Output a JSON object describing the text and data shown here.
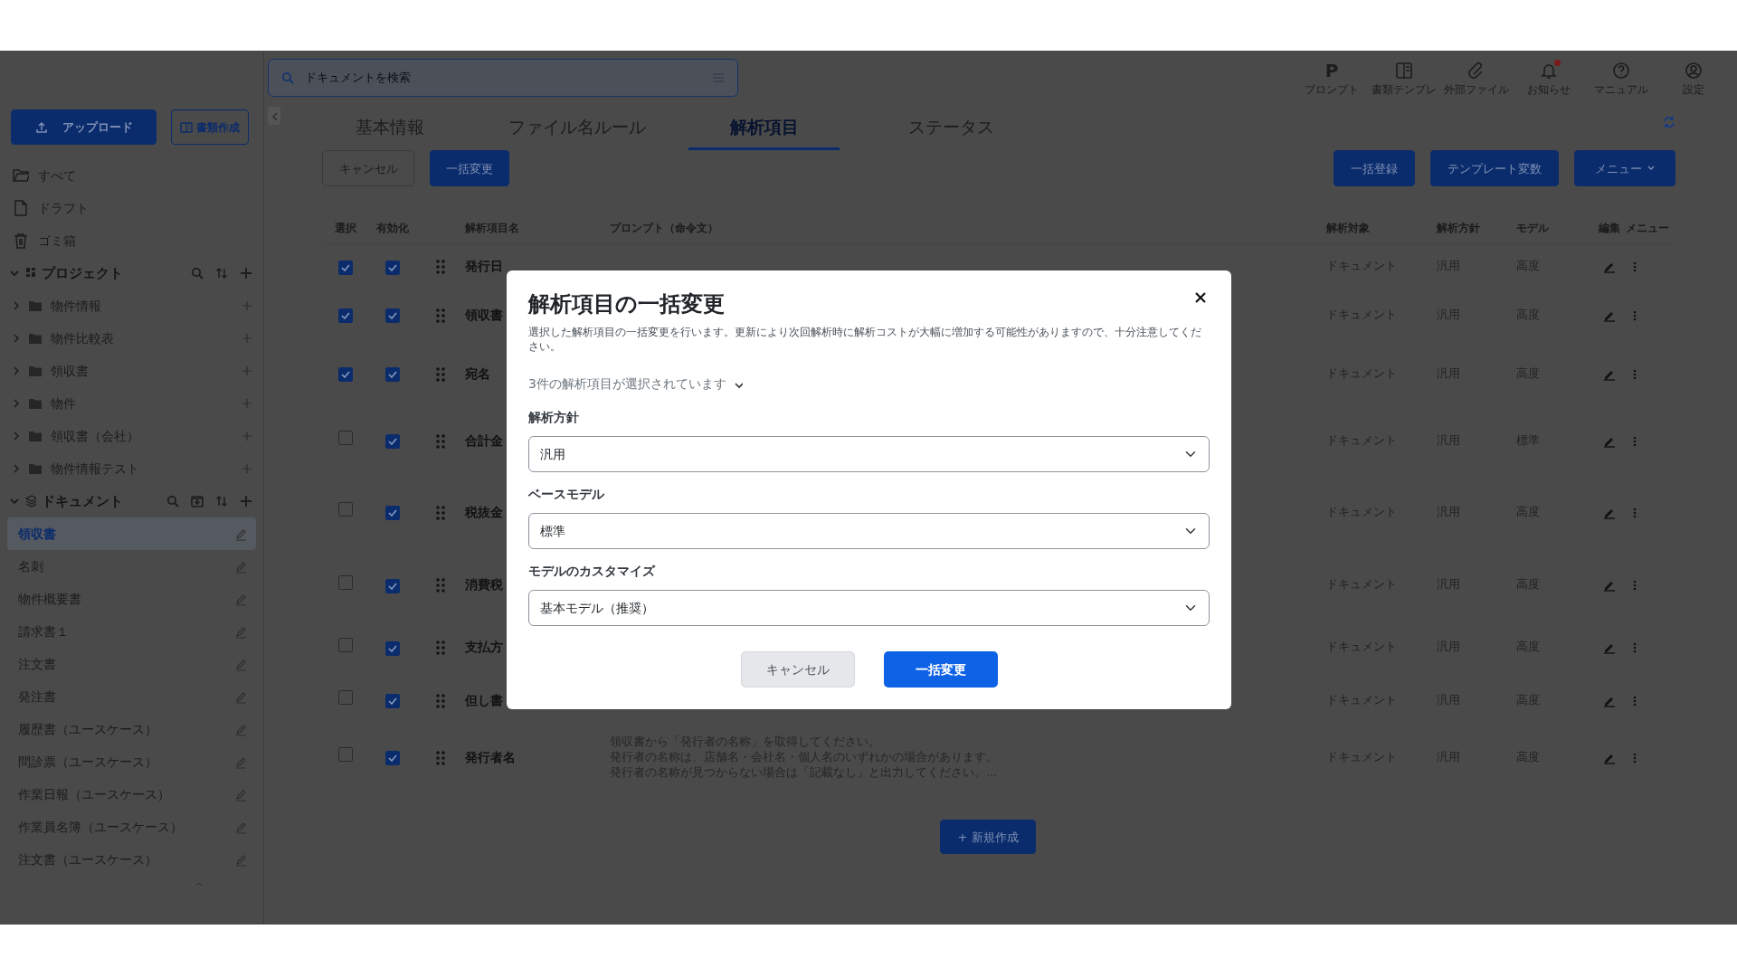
{
  "sidebar": {
    "upload_button": "アップロード",
    "create_button": "書類作成",
    "nav": [
      {
        "label": "すべて"
      },
      {
        "label": "ドラフト"
      },
      {
        "label": "ゴミ箱"
      }
    ],
    "projects": {
      "title": "プロジェクト",
      "expanded": true,
      "items": [
        {
          "label": "物件情報",
          "expanded": false
        },
        {
          "label": "物件比較表",
          "expanded": false
        },
        {
          "label": "領収書",
          "expanded": false
        },
        {
          "label": "物件",
          "expanded": false
        },
        {
          "label": "領収書（会社）",
          "expanded": false
        },
        {
          "label": "物件情報テスト",
          "expanded": false
        }
      ]
    },
    "documents": {
      "title": "ドキュメント",
      "expanded": true,
      "items": [
        {
          "label": "領収書",
          "selected": true
        },
        {
          "label": "名刺",
          "selected": false
        },
        {
          "label": "物件概要書",
          "selected": false
        },
        {
          "label": "請求書１",
          "selected": false
        },
        {
          "label": "注文書",
          "selected": false
        },
        {
          "label": "発注書",
          "selected": false
        },
        {
          "label": "履歴書（ユースケース）",
          "selected": false
        },
        {
          "label": "問診票（ユースケース）",
          "selected": false
        },
        {
          "label": "作業日報（ユースケース）",
          "selected": false
        },
        {
          "label": "作業員名簿（ユースケース）",
          "selected": false
        },
        {
          "label": "注文書（ユースケース）",
          "selected": false
        }
      ]
    }
  },
  "search": {
    "placeholder": "ドキュメントを検索"
  },
  "toolbar": [
    {
      "label": "プロンプト",
      "glyph": "P",
      "unread": false
    },
    {
      "label": "書類テンプレ",
      "unread": false
    },
    {
      "label": "外部ファイル",
      "unread": false
    },
    {
      "label": "お知らせ",
      "unread": true
    },
    {
      "label": "マニュアル",
      "unread": false
    },
    {
      "label": "設定",
      "unread": false
    }
  ],
  "tabs": [
    {
      "label": "基本情報",
      "selected": false
    },
    {
      "label": "ファイル名ルール",
      "selected": false
    },
    {
      "label": "解析項目",
      "selected": true
    },
    {
      "label": "ステータス",
      "selected": false
    }
  ],
  "actions_left": [
    "キャンセル",
    "一括変更"
  ],
  "actions_right": [
    "一括登録",
    "テンプレート変数",
    "メニュー"
  ],
  "table": {
    "columns": [
      "選択",
      "有効化",
      "解析項目名",
      "プロンプト（命令文）",
      "解析対象",
      "解析方針",
      "モデル",
      "編集",
      "メニュー"
    ],
    "rows": [
      {
        "selected": true,
        "enabled": true,
        "name": "発行日",
        "target": "ドキュメント",
        "policy": "汎用",
        "model": "高度"
      },
      {
        "selected": true,
        "enabled": true,
        "name": "領収書",
        "target": "ドキュメント",
        "policy": "汎用",
        "model": "高度"
      },
      {
        "selected": true,
        "enabled": true,
        "name": "宛名",
        "target": "ドキュメント",
        "policy": "汎用",
        "model": "高度"
      },
      {
        "selected": false,
        "enabled": true,
        "name": "合計金",
        "target": "ドキュメント",
        "policy": "汎用",
        "model": "標準"
      },
      {
        "selected": false,
        "enabled": true,
        "name": "税抜金",
        "target": "ドキュメント",
        "policy": "汎用",
        "model": "高度"
      },
      {
        "selected": false,
        "enabled": true,
        "name": "消費税",
        "target": "ドキュメント",
        "policy": "汎用",
        "model": "高度"
      },
      {
        "selected": false,
        "enabled": true,
        "name": "支払方",
        "target": "ドキュメント",
        "policy": "汎用",
        "model": "高度"
      },
      {
        "selected": false,
        "enabled": true,
        "name": "但し書",
        "target": "ドキュメント",
        "policy": "汎用",
        "model": "高度"
      },
      {
        "selected": false,
        "enabled": true,
        "name": "発行者名",
        "prompt": [
          "領収書から「発行者の名称」を取得してください。",
          "発行者の名称は、店舗名・会社名・個人名のいずれかの場合があります。",
          "発行者の名称が見つからない場合は「記載なし」と出力してください。..."
        ],
        "target": "ドキュメント",
        "policy": "汎用",
        "model": "高度"
      }
    ]
  },
  "new_button": "+ 新規作成",
  "modal": {
    "title": "解析項目の一括変更",
    "description": "選択した解析項目の一括変更を行います。更新により次回解析時に解析コストが大幅に増加する可能性がありますので、十分注意してください。",
    "selection_summary": "3件の解析項目が選択されています",
    "fields": [
      {
        "label": "解析方針",
        "value": "汎用"
      },
      {
        "label": "ベースモデル",
        "value": "標準"
      },
      {
        "label": "モデルのカスタマイズ",
        "value": "基本モデル（推奨）"
      }
    ],
    "cancel_button": "キャンセル",
    "submit_button": "一括変更"
  }
}
